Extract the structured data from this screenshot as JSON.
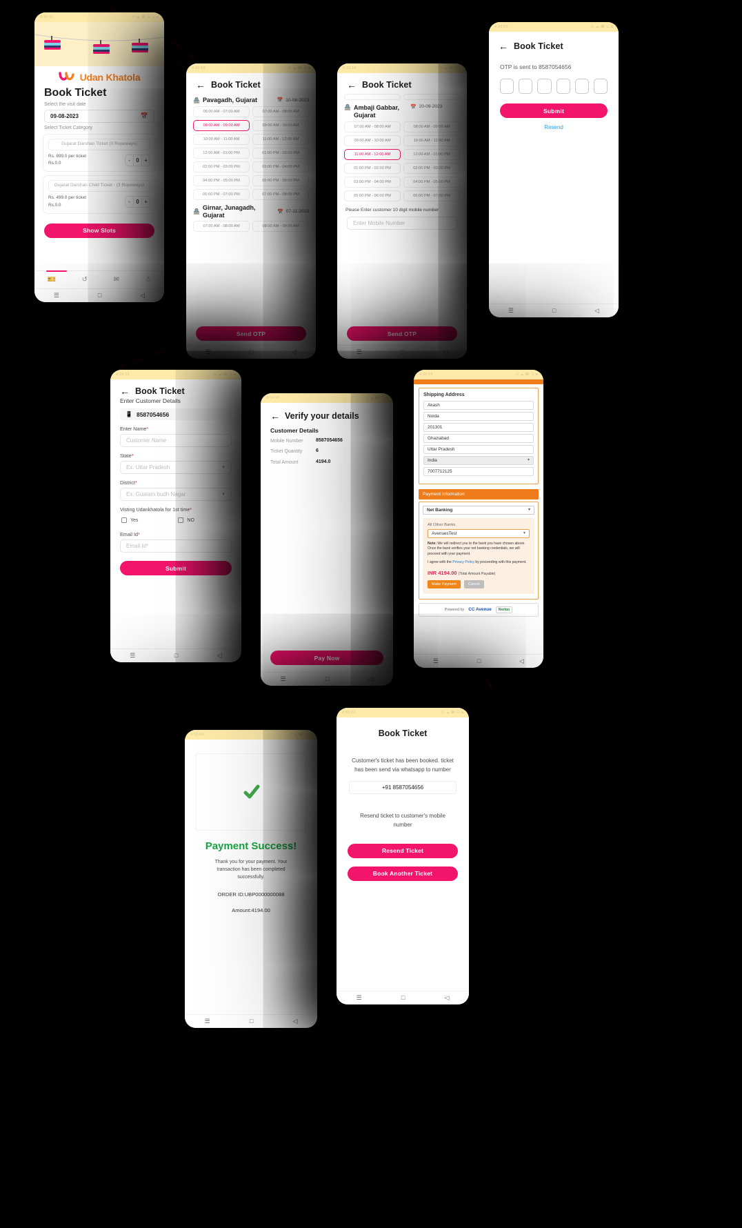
{
  "brand": {
    "name": "Udan Khatola",
    "accent": "#f3146c",
    "orange": "#ef7c1b",
    "green": "#18a742"
  },
  "screens": {
    "book_ticket": {
      "status_time": "4:26:21",
      "logo_text": "Udan Khatola",
      "title": "Book Ticket",
      "date_label": "Select the visit date",
      "date_value": "09-08-2023",
      "calendar_icon": "calendar-icon",
      "category_label": "Select Ticket Category",
      "tickets": [
        {
          "name": "Gujarat Darshan Ticket (3 Ropeways)",
          "price_per": "Rs. 899.0 per ticket",
          "subtotal": "Rs.0.0",
          "qty": "0",
          "minus": "-",
          "plus": "+"
        },
        {
          "name": "Gujarat Darshan Child Ticket - (3 Ropeways)",
          "price_per": "Rs. 499.0 per ticket",
          "subtotal": "Rs.0.0",
          "qty": "0",
          "minus": "-",
          "plus": "+"
        }
      ],
      "cta": "Show Slots",
      "tabs": [
        "ticket-icon",
        "history-icon",
        "chat-icon",
        "profile-icon"
      ]
    },
    "slots_1": {
      "status_time": "4:29:09",
      "title": "Book Ticket",
      "back_icon": "back-arrow-icon",
      "locations": [
        {
          "name": "Pavagadh, Gujarat",
          "icon": "temple-icon",
          "cal_icon": "calendar-icon",
          "date": "10-08-2023",
          "slots": [
            "06:00 AM - 07:00 AM",
            "07:00 AM - 08:00 AM",
            "08:00 AM - 09:00 AM",
            "09:00 AM - 10:00 AM",
            "10:00 AM - 11:00 AM",
            "11:00 AM - 12:00 AM",
            "12:00 AM - 01:00 PM",
            "01:00 PM - 02:00 PM",
            "02:00 PM - 03:00 PM",
            "03:00 PM - 04:00 PM",
            "04:00 PM - 05:00 PM",
            "05:00 PM - 06:00 PM",
            "06:00 PM - 07:00 PM",
            "07:00 PM - 08:00 PM"
          ],
          "selected_index": 2
        },
        {
          "name": "Girnar, Junagadh, Gujarat",
          "icon": "temple-icon",
          "cal_icon": "calendar-icon",
          "date": "07-11-2023",
          "slots": [
            "07:00 AM - 08:00 AM",
            "08:00 AM - 09:00 AM"
          ],
          "selected_index": -1
        }
      ],
      "cta": "Send OTP"
    },
    "slots_2": {
      "status_time": "4:33:14",
      "title": "Book Ticket",
      "back_icon": "back-arrow-icon",
      "location": {
        "name": "Ambaji Gabbar, Gujarat",
        "icon": "temple-icon",
        "cal_icon": "calendar-icon",
        "date": "20-09-2023",
        "slots": [
          "07:00 AM - 08:00 AM",
          "08:00 AM - 09:00 AM",
          "09:00 AM - 10:00 AM",
          "10:00 AM - 11:00 AM",
          "11:00 AM - 12:00 AM",
          "12:00 AM - 01:00 PM",
          "01:00 PM - 02:00 PM",
          "02:00 PM - 03:00 PM",
          "03:00 PM - 04:00 PM",
          "04:00 PM - 05:00 PM",
          "05:00 PM - 06:00 PM",
          "06:00 PM - 07:00 PM"
        ],
        "selected_index": 4
      },
      "mobile_label": "Please Enter customer 10 digit mobile number",
      "mobile_placeholder": "Enter Mobile Number",
      "cta": "Send OTP"
    },
    "otp": {
      "status_time": "4:33:53",
      "title": "Book Ticket",
      "back_icon": "back-arrow-icon",
      "sent_text": "OTP is sent to 8587054656",
      "boxes": 6,
      "submit": "Submit",
      "resend": "Resend"
    },
    "customer": {
      "status_time": "4:34:23",
      "title": "Book Ticket",
      "back_icon": "back-arrow-icon",
      "subtitle": "Enter Customer Details",
      "phone_icon": "mobile-icon",
      "phone_value": "8587054656",
      "name_label": "Enter Name",
      "name_placeholder": "Customer Name",
      "state_label": "State",
      "state_placeholder": "Ex. Uttar Pradesh",
      "district_label": "District",
      "district_placeholder": "Ex. Guatam budh Nagar",
      "visit_label": "Visting Udankhatola for 1st time",
      "yes": "Yes",
      "no": "NO",
      "email_label": "Email Id",
      "email_placeholder": "Email Id*",
      "required_mark": "*",
      "submit": "Submit"
    },
    "verify": {
      "status_time": "4:54:20",
      "title": "Verify your details",
      "back_icon": "back-arrow-icon",
      "section": "Customer Details",
      "rows": [
        {
          "k": "Mobile Number",
          "v": "8587054656"
        },
        {
          "k": "Ticket Quantity",
          "v": "6"
        },
        {
          "k": "Total Amount",
          "v": "4194.0"
        }
      ],
      "cta": "Pay Now"
    },
    "ccavenue": {
      "status_time": "4:56:14",
      "shipping_heading": "Shipping Address",
      "shipping_fields": [
        "Akash",
        "Noida",
        "201301",
        "Ghaziabad",
        "Uttar Pradesh",
        "India",
        "7007712125"
      ],
      "country_is_select": true,
      "payment_band": "Payment Information",
      "method_label": "Net Banking",
      "bank_group_label": "All Other Banks",
      "bank_value": "AvenuesTest",
      "note_bold": "Note:",
      "note": " We will redirect you to the bank you have chosen above. Once the bank verifies your net banking credentials, we will proceed with your payment.",
      "agree_pre": "I agree with the ",
      "agree_link": "Privacy Policy",
      "agree_post": " by proceeding with this payment.",
      "amount": "INR 4194.00",
      "amount_note": "(Total Amount Payable)",
      "make_payment": "Make Payment",
      "cancel": "Cancel",
      "powered_by": "Powered by",
      "cc_logo": "CC Avenue",
      "norton": "Norton"
    },
    "success": {
      "status_time": "4:59:06",
      "title": "Payment Success!",
      "message": "Thank you for your payment. Your transaction has been completed successfully.",
      "order_id": "ORDER ID:UBP0000000088",
      "amount": "Amount:4194.00",
      "check_icon": "check-icon"
    },
    "confirm": {
      "status_time": "4:59:22",
      "title": "Book Ticket",
      "message": "Customer's ticket has been booked. ticket has been send via whatsapp to number",
      "number": "+91 8587054656",
      "resend_prompt": "Resend ticket to customer's mobile number",
      "resend_btn": "Resend Ticket",
      "book_btn": "Book Another Ticket"
    }
  },
  "nav": {
    "menu": "menu-icon",
    "home": "home-icon",
    "back": "back-icon"
  }
}
